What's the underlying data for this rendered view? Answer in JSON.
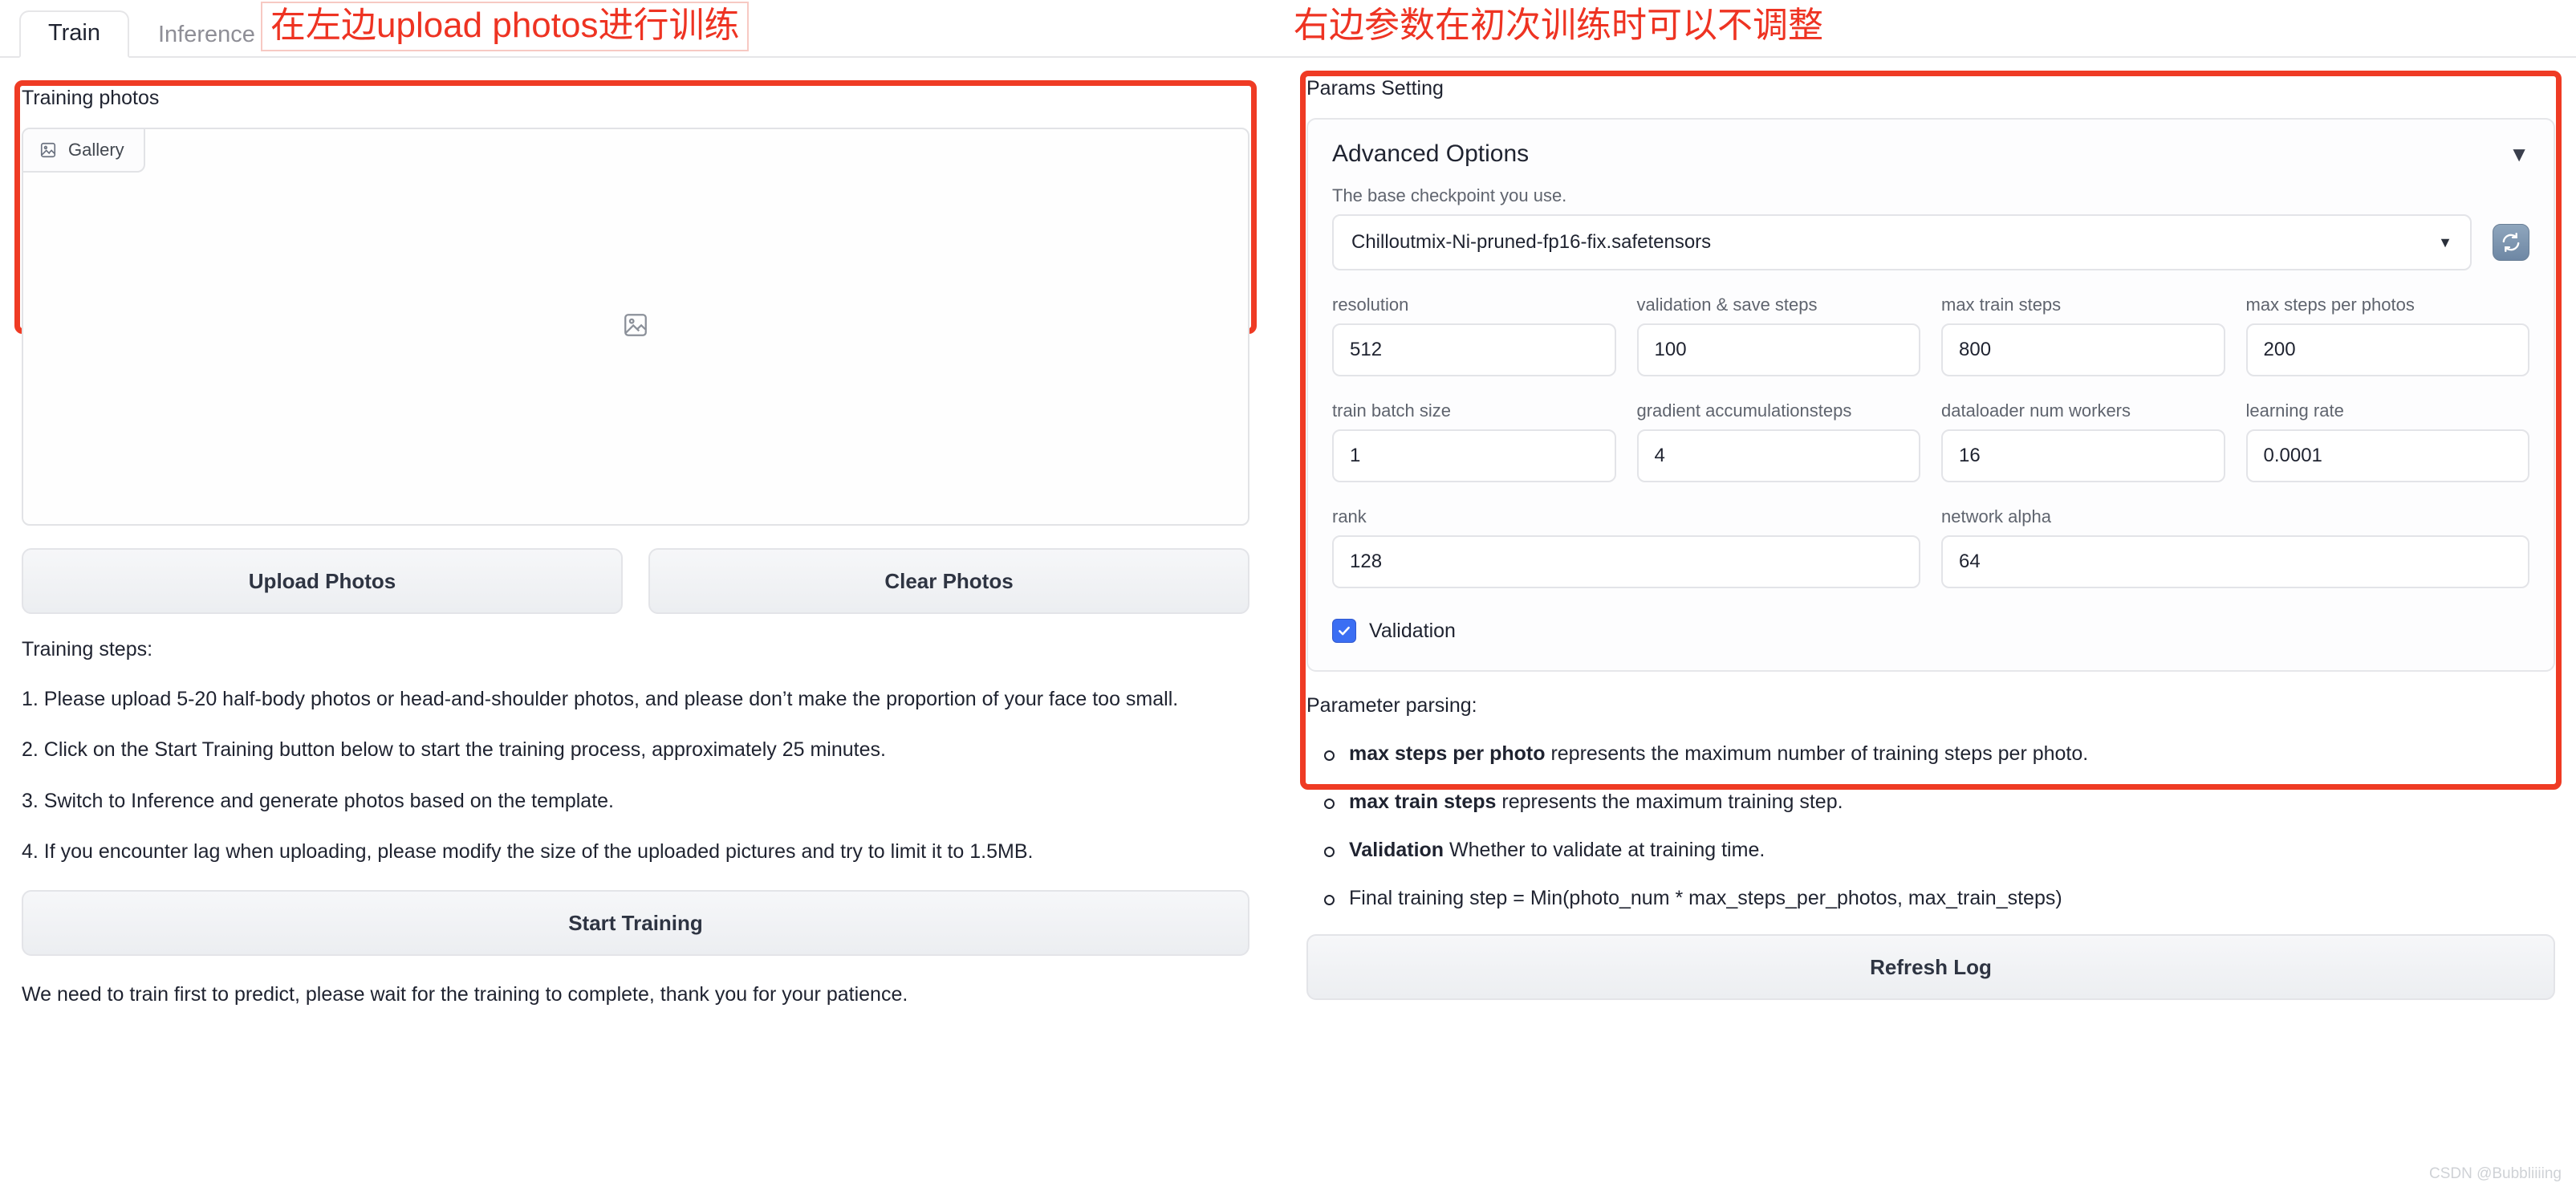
{
  "tabs": [
    {
      "label": "Train",
      "active": true
    },
    {
      "label": "Inference",
      "active": false
    }
  ],
  "annotations": {
    "left": "在左边upload photos进行训练",
    "right": "右边参数在初次训练时可以不调整",
    "accent_color": "#ef3b24"
  },
  "left_panel": {
    "label": "Training photos",
    "gallery_tab_label": "Gallery",
    "gallery_icon": "image-placeholder-icon",
    "upload_button": "Upload Photos",
    "clear_button": "Clear Photos",
    "steps_title": "Training steps:",
    "steps": [
      "1. Please upload 5-20 half-body photos or head-and-shoulder photos, and please don’t make the proportion of your face too small.",
      "2. Click on the Start Training button below to start the training process, approximately 25 minutes.",
      "3. Switch to Inference and generate photos based on the template.",
      "4. If you encounter lag when uploading, please modify the size of the uploaded pictures and try to limit it to 1.5MB."
    ],
    "start_training_button": "Start Training",
    "footnote": "We need to train first to predict, please wait for the training to complete, thank you for your patience."
  },
  "right_panel": {
    "label": "Params Setting",
    "advanced_options_title": "Advanced Options",
    "collapse_caret": "▼",
    "checkpoint": {
      "label": "The base checkpoint you use.",
      "value": "Chilloutmix-Ni-pruned-fp16-fix.safetensors",
      "caret": "▼",
      "refresh_icon": "refresh-icon"
    },
    "fields_row1": [
      {
        "label": "resolution",
        "value": "512"
      },
      {
        "label": "validation & save steps",
        "value": "100"
      },
      {
        "label": "max train steps",
        "value": "800"
      },
      {
        "label": "max steps per photos",
        "value": "200"
      }
    ],
    "fields_row2": [
      {
        "label": "train batch size",
        "value": "1"
      },
      {
        "label": "gradient accumulationsteps",
        "value": "4"
      },
      {
        "label": "dataloader num workers",
        "value": "16"
      },
      {
        "label": "learning rate",
        "value": "0.0001"
      }
    ],
    "fields_row3": [
      {
        "label": "rank",
        "value": "128"
      },
      {
        "label": "network alpha",
        "value": "64"
      }
    ],
    "validation_checkbox": {
      "label": "Validation",
      "checked": true,
      "color": "#3b6ef3"
    },
    "parsing_title": "Parameter parsing:",
    "parsing_items": [
      {
        "bold": "max steps per photo",
        "rest": " represents the maximum number of training steps per photo."
      },
      {
        "bold": "max train steps",
        "rest": " represents the maximum training step."
      },
      {
        "bold": "Validation",
        "rest": " Whether to validate at training time."
      },
      {
        "bold": "",
        "rest": "Final training step = Min(photo_num * max_steps_per_photos, max_train_steps)"
      }
    ],
    "refresh_log_button": "Refresh Log"
  },
  "watermark": "CSDN @Bubbliiiing"
}
